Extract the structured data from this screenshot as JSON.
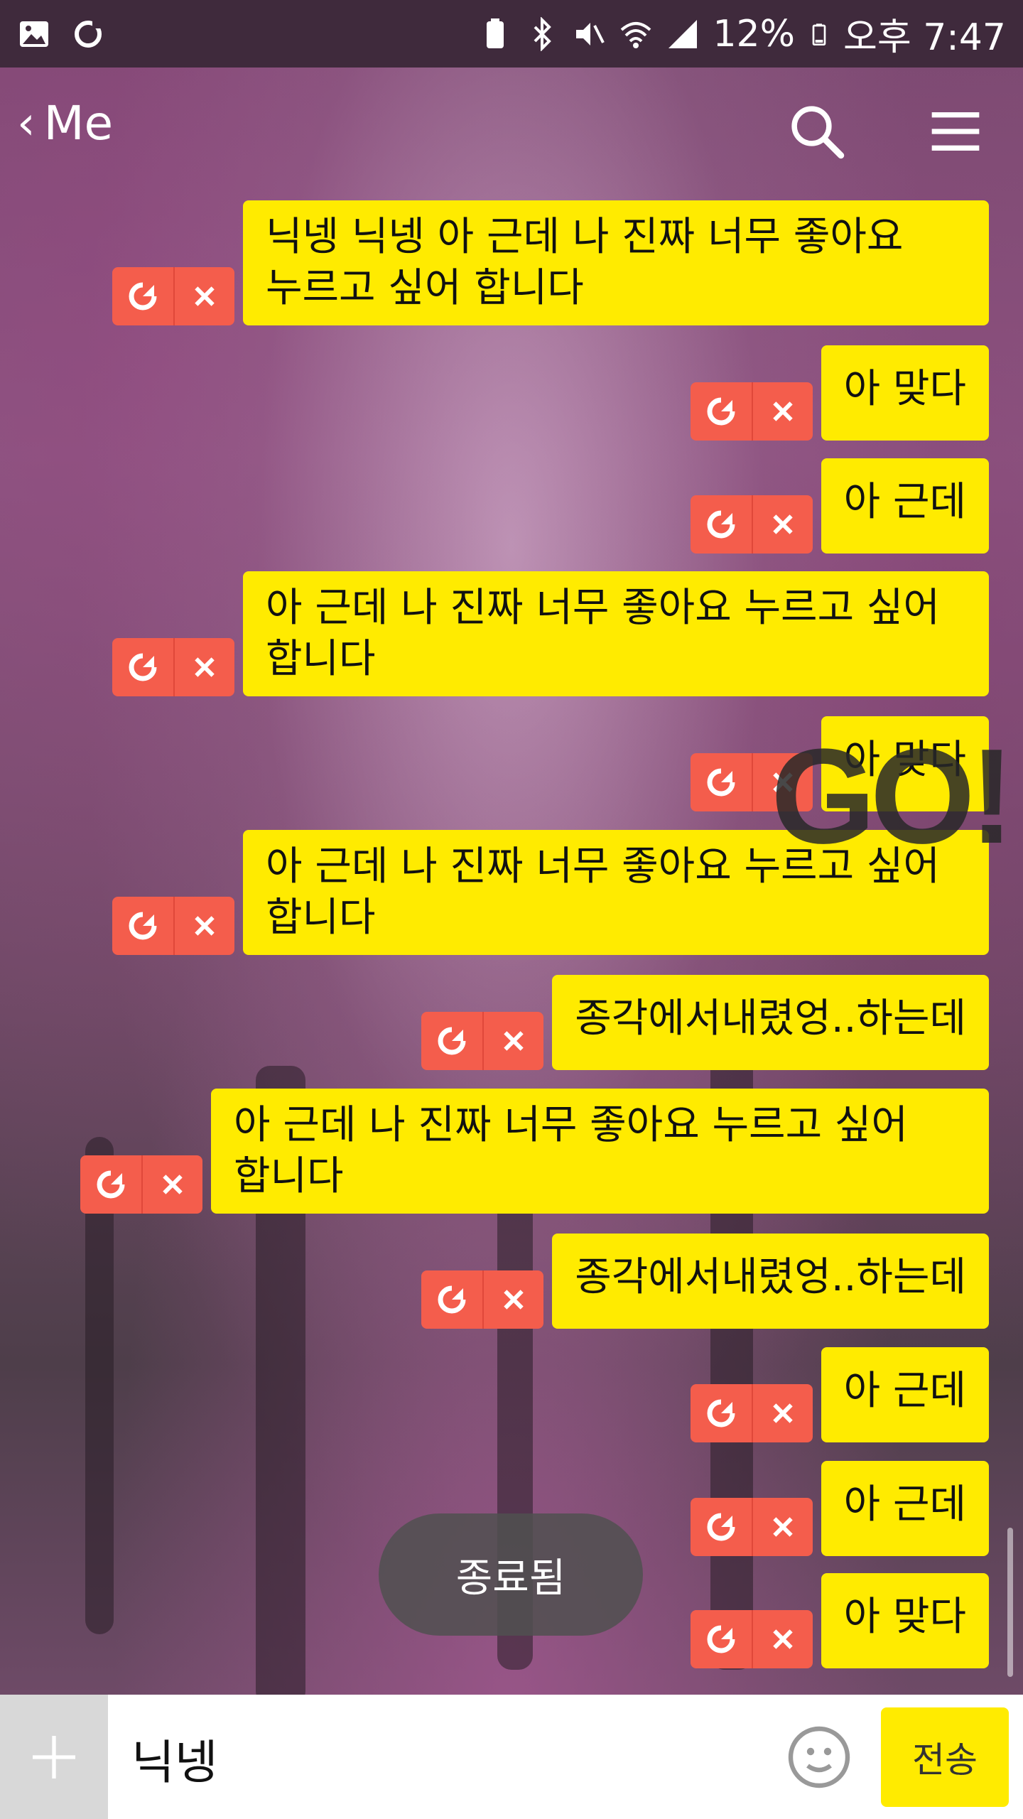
{
  "status_bar": {
    "battery_percent": "12%",
    "time": "오후 7:47"
  },
  "header": {
    "back_label": "Me",
    "search_icon": "search-icon",
    "menu_icon": "hamburger-menu-icon"
  },
  "messages": [
    {
      "text": "닉넹 닉넹 아 근데 나 진짜 너무 좋아요\n누르고 싶어 합니다"
    },
    {
      "text": "아 맞다"
    },
    {
      "text": "아 근데"
    },
    {
      "text": "아 근데 나 진짜 너무 좋아요 누르고 싶어\n합니다"
    },
    {
      "text": "아 맞다"
    },
    {
      "text": "아 근데 나 진짜 너무 좋아요 누르고 싶어\n합니다"
    },
    {
      "text": "종각에서내렸엉..하는데"
    },
    {
      "text": "아 근데 나 진짜 너무 좋아요 누르고 싶어\n합니다"
    },
    {
      "text": "종각에서내렸엉..하는데"
    },
    {
      "text": "아 근데"
    },
    {
      "text": "아 근데"
    },
    {
      "text": "아 맞다"
    }
  ],
  "overlay_text": "GO!",
  "toast": "종료됨",
  "input": {
    "value": "닉넹",
    "send_label": "전송"
  },
  "colors": {
    "bubble": "#ffeb00",
    "action_button": "#f45d4c",
    "status_bar": "#3f2a3c"
  }
}
